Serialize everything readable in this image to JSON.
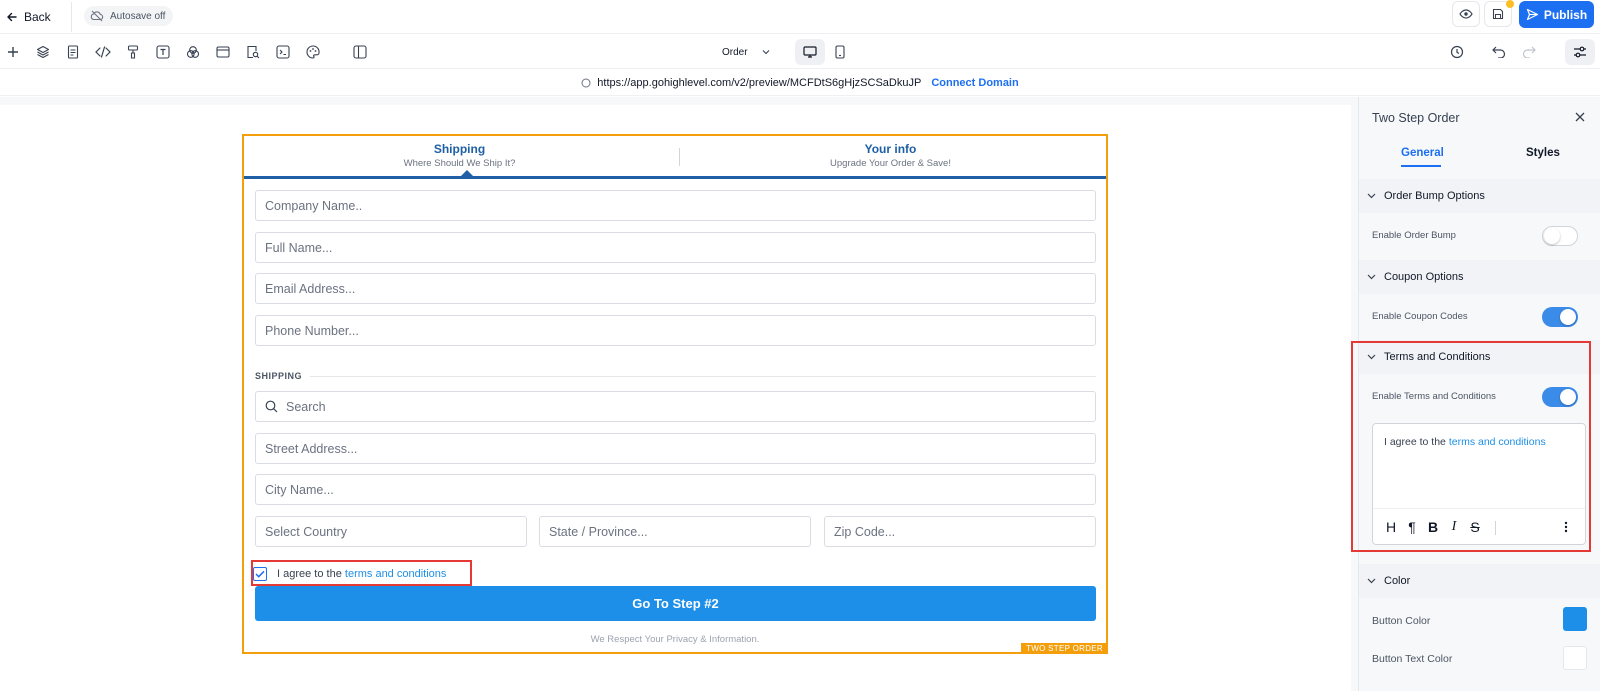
{
  "topbar": {
    "back_label": "Back",
    "autosave_label": "Autosave off",
    "publish_label": "Publish"
  },
  "toolbar": {
    "page_select": "Order",
    "tools": [
      "plus-icon",
      "layers-icon",
      "page-icon",
      "code-icon",
      "paint-roller-icon",
      "text-icon",
      "color-circles-icon",
      "window-icon",
      "page-search-icon",
      "terminal-icon",
      "palette-icon",
      "split-view-icon"
    ]
  },
  "url": {
    "address": "https://app.gohighlevel.com/v2/preview/MCFDtS6gHjzSCSaDkuJP",
    "connect_label": "Connect Domain"
  },
  "order_form": {
    "tag": "TWO STEP ORDER",
    "steps": [
      {
        "title": "Shipping",
        "subtitle": "Where Should We Ship It?"
      },
      {
        "title": "Your info",
        "subtitle": "Upgrade Your Order & Save!"
      }
    ],
    "fields": {
      "company": "Company Name..",
      "full_name": "Full Name...",
      "email": "Email Address...",
      "phone": "Phone Number...",
      "search": "Search",
      "street": "Street Address...",
      "city": "City Name...",
      "country": "Select Country",
      "state": "State / Province...",
      "zip": "Zip Code..."
    },
    "shipping_label": "SHIPPING",
    "agree_prefix": "I agree to the",
    "agree_link": "terms and conditions",
    "agree_checked": true,
    "button_label": "Go To Step #2",
    "privacy_text": "We Respect Your Privacy & Information."
  },
  "panel": {
    "title": "Two Step Order",
    "tabs": {
      "general": "General",
      "styles": "Styles"
    },
    "sections": {
      "order_bump": {
        "header": "Order Bump Options",
        "label": "Enable Order Bump",
        "enabled": false
      },
      "coupon": {
        "header": "Coupon Options",
        "label": "Enable Coupon Codes",
        "enabled": true
      },
      "terms": {
        "header": "Terms and Conditions",
        "label": "Enable Terms and Conditions",
        "enabled": true,
        "editor_prefix": "I agree to the",
        "editor_link": "terms and conditions",
        "format_tools": [
          "H",
          "¶",
          "B",
          "I",
          "S"
        ]
      },
      "color": {
        "header": "Color",
        "button_color_label": "Button Color",
        "button_color": "#1d8fe8",
        "button_text_color_label": "Button Text Color",
        "button_text_color": "#ffffff"
      }
    }
  },
  "colors": {
    "accent": "#1d6ff2",
    "step_blue": "#1e5fa5",
    "selection_orange": "#f59e0b",
    "highlight_red": "#e53935"
  }
}
